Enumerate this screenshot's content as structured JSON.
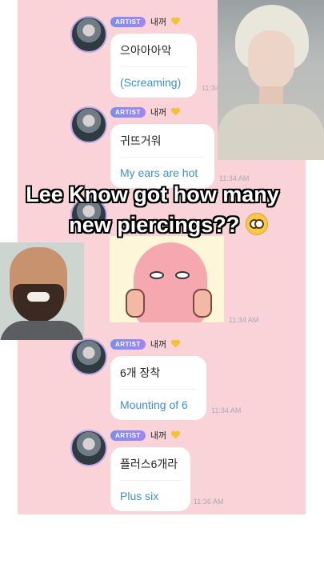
{
  "messages": [
    {
      "badge": "ARTIST",
      "sender": "내꺼",
      "original": "으아아아악",
      "translation": "(Screaming)",
      "time": "11:34 AM"
    },
    {
      "badge": "ARTIST",
      "sender": "내꺼",
      "original": "귀뜨거워",
      "translation": "My ears are hot",
      "time": "11:34 AM"
    },
    {
      "badge": "ARTIST",
      "sender": "내꺼",
      "original": "6개 장착",
      "translation": "Mounting of 6",
      "time": "11:34 AM"
    },
    {
      "badge": "ARTIST",
      "sender": "내꺼",
      "original": "플러스6개라",
      "translation": "Plus six",
      "time": "11:36 AM"
    }
  ],
  "sticker_time": "11:34 AM",
  "overlay_caption": {
    "line1": "Lee Know got how many",
    "line2": "new piercings??"
  },
  "icons": {
    "emoji": "flushed-face-icon",
    "badge_heart": "yellow-heart-icon"
  },
  "colors": {
    "chat_background": "#f9d3d8",
    "translation_text": "#3d8fd4",
    "artist_badge": "#8a8cf2"
  }
}
